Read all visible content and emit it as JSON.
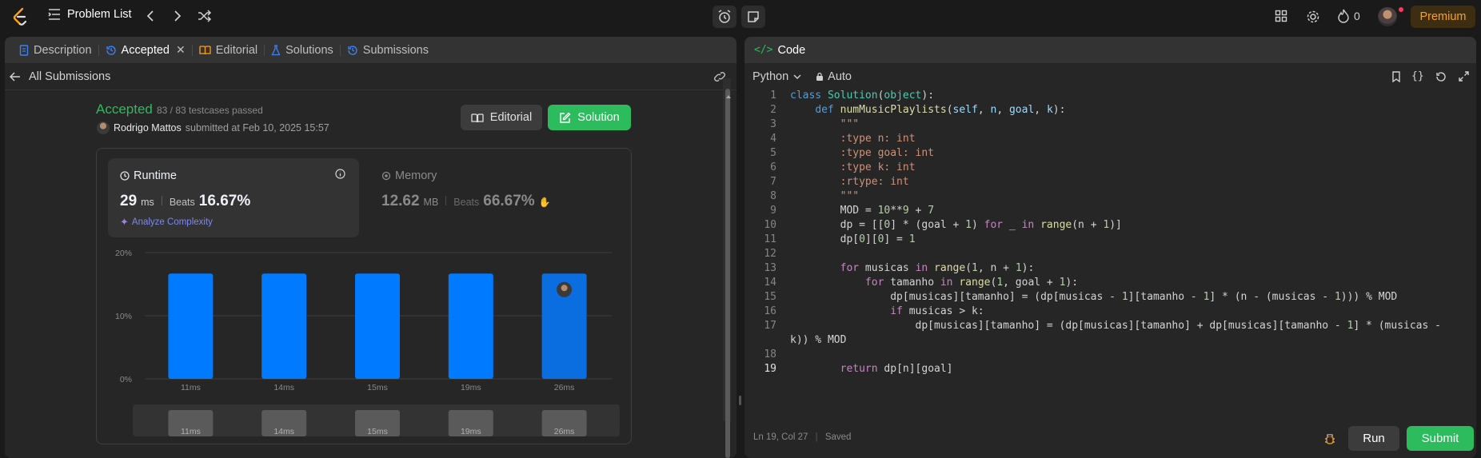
{
  "topbar": {
    "problem_list_label": "Problem List",
    "streak_count": "0",
    "premium_label": "Premium"
  },
  "left_panel": {
    "tabs": [
      {
        "label": "Description"
      },
      {
        "label": "Accepted"
      },
      {
        "label": "Editorial"
      },
      {
        "label": "Solutions"
      },
      {
        "label": "Submissions"
      }
    ],
    "back_label": "All Submissions"
  },
  "result": {
    "status": "Accepted",
    "testcases": "83 / 83 testcases passed",
    "user": "Rodrigo Mattos",
    "submitted_text": "submitted at Feb 10, 2025 15:57",
    "editorial_btn": "Editorial",
    "solution_btn": "Solution",
    "runtime": {
      "label": "Runtime",
      "value": "29",
      "unit": "ms",
      "beats_label": "Beats",
      "beats": "16.67%",
      "analyze": "Analyze Complexity"
    },
    "memory": {
      "label": "Memory",
      "value": "12.62",
      "unit": "MB",
      "beats_label": "Beats",
      "beats": "66.67%"
    }
  },
  "chart_data": {
    "type": "bar",
    "categories": [
      "11ms",
      "14ms",
      "15ms",
      "19ms",
      "26ms"
    ],
    "values": [
      16.67,
      16.67,
      16.67,
      16.67,
      16.67
    ],
    "ylim": [
      0,
      20
    ],
    "yticks": [
      "20%",
      "10%",
      "0%"
    ],
    "highlight_index": 4,
    "colors": {
      "bar": "#007aff",
      "highlight": "#0a6de0"
    },
    "minimap_labels": [
      "11ms",
      "14ms",
      "15ms",
      "19ms",
      "26ms"
    ]
  },
  "right_panel": {
    "title": "Code",
    "language": "Python",
    "mode": "Auto",
    "status_position": "Ln 19, Col 27",
    "status_saved": "Saved",
    "run_label": "Run",
    "submit_label": "Submit"
  },
  "code_lines": [
    "1",
    "2",
    "3",
    "4",
    "5",
    "6",
    "7",
    "8",
    "9",
    "10",
    "11",
    "12",
    "13",
    "14",
    "15",
    "16",
    "17",
    "18",
    "19"
  ]
}
